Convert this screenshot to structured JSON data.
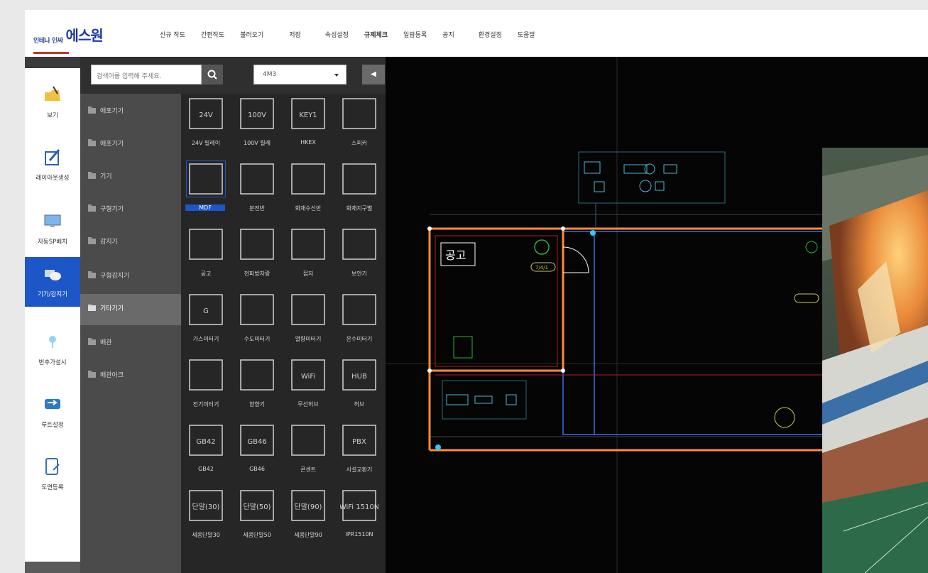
{
  "app": {
    "logo_small": "인테나 인싸",
    "logo_main": "에스원"
  },
  "menu": [
    "신규 작도",
    "간편작도",
    "불러오기",
    "저장",
    "속성설정",
    "규제체크",
    "일람등록",
    "공지",
    "환경설정",
    "도움말"
  ],
  "sidebar": [
    {
      "label": "보기",
      "icon": "folder-view-icon"
    },
    {
      "label": "레이아웃생성",
      "icon": "pencil-layout-icon"
    },
    {
      "label": "자동SP배치",
      "icon": "monitor-icon"
    },
    {
      "label": "기기/감지기",
      "icon": "hand-device-icon",
      "active": true
    },
    {
      "label": "번추가설시",
      "icon": "lamp-icon"
    },
    {
      "label": "루트설정",
      "icon": "route-arrows-icon"
    },
    {
      "label": "도면등록",
      "icon": "tablet-register-icon"
    }
  ],
  "search": {
    "placeholder": "검색어를 입력해 주세요."
  },
  "select": {
    "value": "4M3"
  },
  "categories": [
    {
      "label": "애포기기"
    },
    {
      "label": "애포기기"
    },
    {
      "label": "기기"
    },
    {
      "label": "구형기기"
    },
    {
      "label": "감지기"
    },
    {
      "label": "구형감지기"
    },
    {
      "label": "기타기기",
      "active": true
    },
    {
      "label": "배관"
    },
    {
      "label": "배관아크"
    }
  ],
  "symbols": [
    {
      "label": "24V 릴레이",
      "glyph": "24V"
    },
    {
      "label": "100V 릴레",
      "glyph": "100V"
    },
    {
      "label": "HKEX",
      "glyph": "KEY1"
    },
    {
      "label": "스피커",
      "glyph": ""
    },
    {
      "label": "MDF",
      "glyph": "",
      "selected": true
    },
    {
      "label": "분전반",
      "glyph": ""
    },
    {
      "label": "화재수신반",
      "glyph": ""
    },
    {
      "label": "화재지구별",
      "glyph": ""
    },
    {
      "label": "공고",
      "glyph": ""
    },
    {
      "label": "전파방차랑",
      "glyph": ""
    },
    {
      "label": "접지",
      "glyph": ""
    },
    {
      "label": "보안기",
      "glyph": ""
    },
    {
      "label": "가스미터기",
      "glyph": "G"
    },
    {
      "label": "수도미터기",
      "glyph": ""
    },
    {
      "label": "열량미터기",
      "glyph": ""
    },
    {
      "label": "온수미터기",
      "glyph": ""
    },
    {
      "label": "전기미터기",
      "glyph": ""
    },
    {
      "label": "향향기",
      "glyph": ""
    },
    {
      "label": "무선허브",
      "glyph": "WiFi"
    },
    {
      "label": "허브",
      "glyph": "HUB"
    },
    {
      "label": "GB42",
      "glyph": "GB42"
    },
    {
      "label": "GB46",
      "glyph": "GB46"
    },
    {
      "label": "콘센트",
      "glyph": ""
    },
    {
      "label": "사설교환기",
      "glyph": "PBX"
    },
    {
      "label": "세콤단말30",
      "glyph": "단말(30)"
    },
    {
      "label": "세콤단말50",
      "glyph": "단말(50)"
    },
    {
      "label": "세콤단말90",
      "glyph": "단말(90)"
    },
    {
      "label": "IPR1510N",
      "glyph": "WiFi 1510N"
    }
  ],
  "canvas": {
    "room_label": "공고",
    "small_tag": "7/4/1"
  },
  "colors": {
    "accent": "#1d56c7",
    "cad_orange": "#ff8c3a",
    "cad_cyan": "#35c6ff",
    "cad_blue": "#3b6fe8"
  }
}
